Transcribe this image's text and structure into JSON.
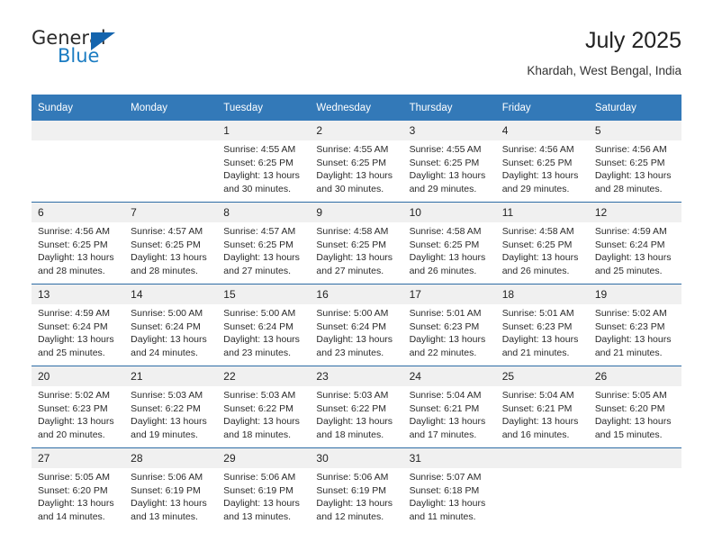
{
  "logo": {
    "word1": "General",
    "word2": "Blue",
    "triangle_color": "#1565ae",
    "blue_color": "#1b7cc2"
  },
  "header": {
    "month_title": "July 2025",
    "location": "Khardah, West Bengal, India"
  },
  "theme": {
    "header_bg": "#3379b8",
    "row_divider": "#2d6ca5",
    "daynum_bg": "#f0f0f0"
  },
  "weekday_headers": [
    "Sunday",
    "Monday",
    "Tuesday",
    "Wednesday",
    "Thursday",
    "Friday",
    "Saturday"
  ],
  "labels": {
    "sunrise": "Sunrise:",
    "sunset": "Sunset:",
    "daylight": "Daylight:"
  },
  "weeks": [
    [
      {
        "day": "",
        "blank": true
      },
      {
        "day": "",
        "blank": true
      },
      {
        "day": "1",
        "sunrise": "Sunrise: 4:55 AM",
        "sunset": "Sunset: 6:25 PM",
        "daylight": "Daylight: 13 hours and 30 minutes."
      },
      {
        "day": "2",
        "sunrise": "Sunrise: 4:55 AM",
        "sunset": "Sunset: 6:25 PM",
        "daylight": "Daylight: 13 hours and 30 minutes."
      },
      {
        "day": "3",
        "sunrise": "Sunrise: 4:55 AM",
        "sunset": "Sunset: 6:25 PM",
        "daylight": "Daylight: 13 hours and 29 minutes."
      },
      {
        "day": "4",
        "sunrise": "Sunrise: 4:56 AM",
        "sunset": "Sunset: 6:25 PM",
        "daylight": "Daylight: 13 hours and 29 minutes."
      },
      {
        "day": "5",
        "sunrise": "Sunrise: 4:56 AM",
        "sunset": "Sunset: 6:25 PM",
        "daylight": "Daylight: 13 hours and 28 minutes."
      }
    ],
    [
      {
        "day": "6",
        "sunrise": "Sunrise: 4:56 AM",
        "sunset": "Sunset: 6:25 PM",
        "daylight": "Daylight: 13 hours and 28 minutes."
      },
      {
        "day": "7",
        "sunrise": "Sunrise: 4:57 AM",
        "sunset": "Sunset: 6:25 PM",
        "daylight": "Daylight: 13 hours and 28 minutes."
      },
      {
        "day": "8",
        "sunrise": "Sunrise: 4:57 AM",
        "sunset": "Sunset: 6:25 PM",
        "daylight": "Daylight: 13 hours and 27 minutes."
      },
      {
        "day": "9",
        "sunrise": "Sunrise: 4:58 AM",
        "sunset": "Sunset: 6:25 PM",
        "daylight": "Daylight: 13 hours and 27 minutes."
      },
      {
        "day": "10",
        "sunrise": "Sunrise: 4:58 AM",
        "sunset": "Sunset: 6:25 PM",
        "daylight": "Daylight: 13 hours and 26 minutes."
      },
      {
        "day": "11",
        "sunrise": "Sunrise: 4:58 AM",
        "sunset": "Sunset: 6:25 PM",
        "daylight": "Daylight: 13 hours and 26 minutes."
      },
      {
        "day": "12",
        "sunrise": "Sunrise: 4:59 AM",
        "sunset": "Sunset: 6:24 PM",
        "daylight": "Daylight: 13 hours and 25 minutes."
      }
    ],
    [
      {
        "day": "13",
        "sunrise": "Sunrise: 4:59 AM",
        "sunset": "Sunset: 6:24 PM",
        "daylight": "Daylight: 13 hours and 25 minutes."
      },
      {
        "day": "14",
        "sunrise": "Sunrise: 5:00 AM",
        "sunset": "Sunset: 6:24 PM",
        "daylight": "Daylight: 13 hours and 24 minutes."
      },
      {
        "day": "15",
        "sunrise": "Sunrise: 5:00 AM",
        "sunset": "Sunset: 6:24 PM",
        "daylight": "Daylight: 13 hours and 23 minutes."
      },
      {
        "day": "16",
        "sunrise": "Sunrise: 5:00 AM",
        "sunset": "Sunset: 6:24 PM",
        "daylight": "Daylight: 13 hours and 23 minutes."
      },
      {
        "day": "17",
        "sunrise": "Sunrise: 5:01 AM",
        "sunset": "Sunset: 6:23 PM",
        "daylight": "Daylight: 13 hours and 22 minutes."
      },
      {
        "day": "18",
        "sunrise": "Sunrise: 5:01 AM",
        "sunset": "Sunset: 6:23 PM",
        "daylight": "Daylight: 13 hours and 21 minutes."
      },
      {
        "day": "19",
        "sunrise": "Sunrise: 5:02 AM",
        "sunset": "Sunset: 6:23 PM",
        "daylight": "Daylight: 13 hours and 21 minutes."
      }
    ],
    [
      {
        "day": "20",
        "sunrise": "Sunrise: 5:02 AM",
        "sunset": "Sunset: 6:23 PM",
        "daylight": "Daylight: 13 hours and 20 minutes."
      },
      {
        "day": "21",
        "sunrise": "Sunrise: 5:03 AM",
        "sunset": "Sunset: 6:22 PM",
        "daylight": "Daylight: 13 hours and 19 minutes."
      },
      {
        "day": "22",
        "sunrise": "Sunrise: 5:03 AM",
        "sunset": "Sunset: 6:22 PM",
        "daylight": "Daylight: 13 hours and 18 minutes."
      },
      {
        "day": "23",
        "sunrise": "Sunrise: 5:03 AM",
        "sunset": "Sunset: 6:22 PM",
        "daylight": "Daylight: 13 hours and 18 minutes."
      },
      {
        "day": "24",
        "sunrise": "Sunrise: 5:04 AM",
        "sunset": "Sunset: 6:21 PM",
        "daylight": "Daylight: 13 hours and 17 minutes."
      },
      {
        "day": "25",
        "sunrise": "Sunrise: 5:04 AM",
        "sunset": "Sunset: 6:21 PM",
        "daylight": "Daylight: 13 hours and 16 minutes."
      },
      {
        "day": "26",
        "sunrise": "Sunrise: 5:05 AM",
        "sunset": "Sunset: 6:20 PM",
        "daylight": "Daylight: 13 hours and 15 minutes."
      }
    ],
    [
      {
        "day": "27",
        "sunrise": "Sunrise: 5:05 AM",
        "sunset": "Sunset: 6:20 PM",
        "daylight": "Daylight: 13 hours and 14 minutes."
      },
      {
        "day": "28",
        "sunrise": "Sunrise: 5:06 AM",
        "sunset": "Sunset: 6:19 PM",
        "daylight": "Daylight: 13 hours and 13 minutes."
      },
      {
        "day": "29",
        "sunrise": "Sunrise: 5:06 AM",
        "sunset": "Sunset: 6:19 PM",
        "daylight": "Daylight: 13 hours and 13 minutes."
      },
      {
        "day": "30",
        "sunrise": "Sunrise: 5:06 AM",
        "sunset": "Sunset: 6:19 PM",
        "daylight": "Daylight: 13 hours and 12 minutes."
      },
      {
        "day": "31",
        "sunrise": "Sunrise: 5:07 AM",
        "sunset": "Sunset: 6:18 PM",
        "daylight": "Daylight: 13 hours and 11 minutes."
      },
      {
        "day": "",
        "blank": true
      },
      {
        "day": "",
        "blank": true
      }
    ]
  ]
}
